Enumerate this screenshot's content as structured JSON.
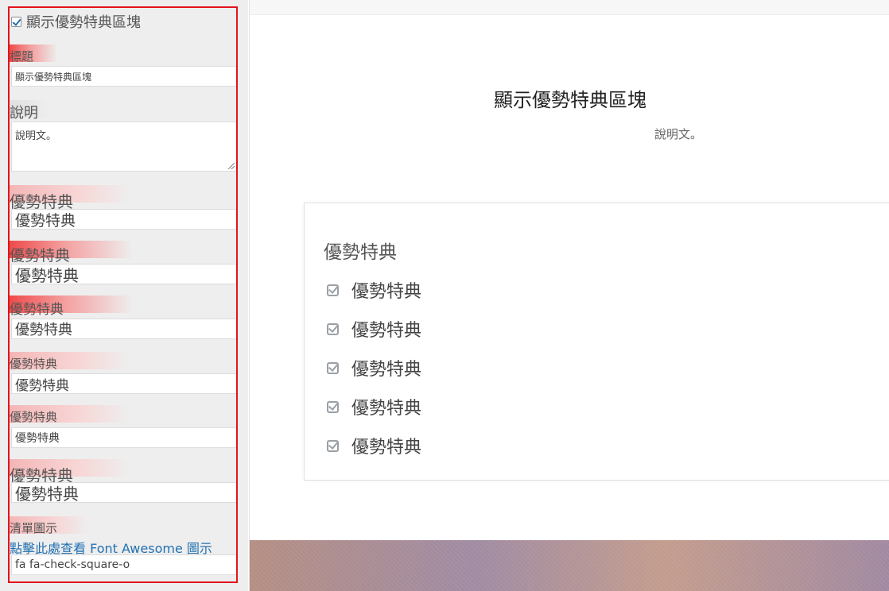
{
  "sidebar": {
    "show_checkbox_label": "顯示優勢特典區塊",
    "title_label": "標題",
    "title_value": "顯示優勢特典區塊",
    "desc_label": "說明",
    "desc_value": "說明文。",
    "features": [
      {
        "label": "優勢特典",
        "value": "優勢特典"
      },
      {
        "label": "優勢特典",
        "value": "優勢特典"
      },
      {
        "label": "優勢特典",
        "value": "優勢特典"
      },
      {
        "label": "優勢特典",
        "value": "優勢特典"
      },
      {
        "label": "優勢特典",
        "value": "優勢特典"
      },
      {
        "label": "優勢特典",
        "value": "優勢特典"
      }
    ],
    "icon_label": "清單圖示",
    "icon_link": "點擊此處查看 Font Awesome 圖示",
    "icon_value": "fa fa-check-square-o"
  },
  "preview": {
    "title": "顯示優勢特典區塊",
    "description": "說明文。",
    "card_title": "優勢特典",
    "items": [
      "優勢特典",
      "優勢特典",
      "優勢特典",
      "優勢特典",
      "優勢特典"
    ],
    "item_icon": "check-square-icon"
  },
  "colors": {
    "highlight_border": "#e3131b",
    "link": "#2271b1",
    "checkbox_check": "#2271b1"
  }
}
